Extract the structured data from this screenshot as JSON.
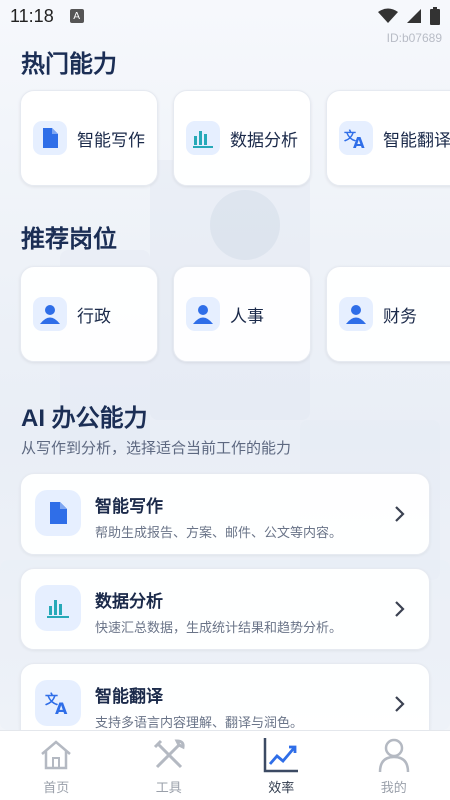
{
  "status_bar": {
    "time": "11:18",
    "badge": "A"
  },
  "id_label": "ID:b07689",
  "hot": {
    "title": "热门能力",
    "items": [
      {
        "label": "智能写作",
        "icon": "document-icon"
      },
      {
        "label": "数据分析",
        "icon": "bar-chart-icon"
      },
      {
        "label": "智能翻译",
        "icon": "translate-icon"
      }
    ]
  },
  "jobs": {
    "title": "推荐岗位",
    "items": [
      {
        "label": "行政",
        "icon": "person-icon"
      },
      {
        "label": "人事",
        "icon": "person-icon"
      },
      {
        "label": "财务",
        "icon": "person-icon"
      }
    ]
  },
  "ai": {
    "title": "AI 办公能力",
    "subtitle": "从写作到分析，选择适合当前工作的能力",
    "cards": [
      {
        "title": "智能写作",
        "desc": "帮助生成报告、方案、邮件、公文等内容。",
        "icon": "document-icon"
      },
      {
        "title": "数据分析",
        "desc": "快速汇总数据，生成统计结果和趋势分析。",
        "icon": "bar-chart-icon"
      },
      {
        "title": "智能翻译",
        "desc": "支持多语言内容理解、翻译与润色。",
        "icon": "translate-icon"
      }
    ]
  },
  "tabs": [
    {
      "label": "首页",
      "icon": "home-icon",
      "active": false
    },
    {
      "label": "工具",
      "icon": "tools-icon",
      "active": false
    },
    {
      "label": "效率",
      "icon": "trend-chart-icon",
      "active": true
    },
    {
      "label": "我的",
      "icon": "profile-icon",
      "active": false
    }
  ],
  "colors": {
    "accent": "#2f6ee8",
    "icon_bg": "#e6efff",
    "heading": "#1b2e55",
    "teal": "#27a9b8"
  }
}
